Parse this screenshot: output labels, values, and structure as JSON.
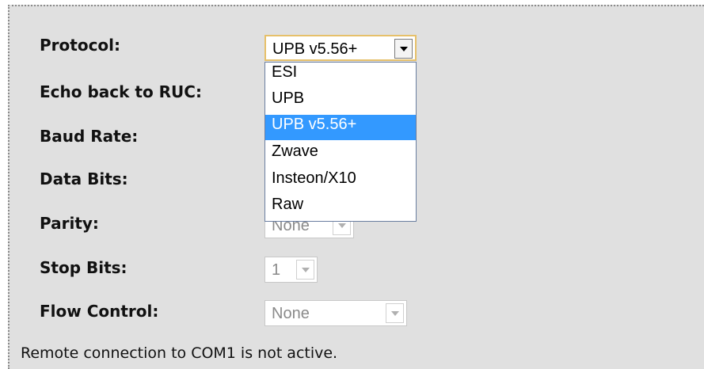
{
  "form": {
    "fields": [
      {
        "label": "Protocol:",
        "value": "UPB v5.56+"
      },
      {
        "label": "Echo back to RUC:"
      },
      {
        "label": "Baud Rate:"
      },
      {
        "label": "Data Bits:"
      },
      {
        "label": "Parity:",
        "value": "None"
      },
      {
        "label": "Stop Bits:",
        "value": "1"
      },
      {
        "label": "Flow Control:",
        "value": "None"
      }
    ]
  },
  "protocol_dropdown": {
    "options": [
      "ESI",
      "UPB",
      "UPB v5.56+",
      "Zwave",
      "Insteon/X10",
      "Raw"
    ],
    "selected": "UPB v5.56+"
  },
  "status": {
    "text": "Remote connection to COM1 is not active."
  },
  "colors": {
    "panel_bg": "#e0e0e0",
    "selection": "#3399ff",
    "focus_border": "#e6c06a"
  }
}
